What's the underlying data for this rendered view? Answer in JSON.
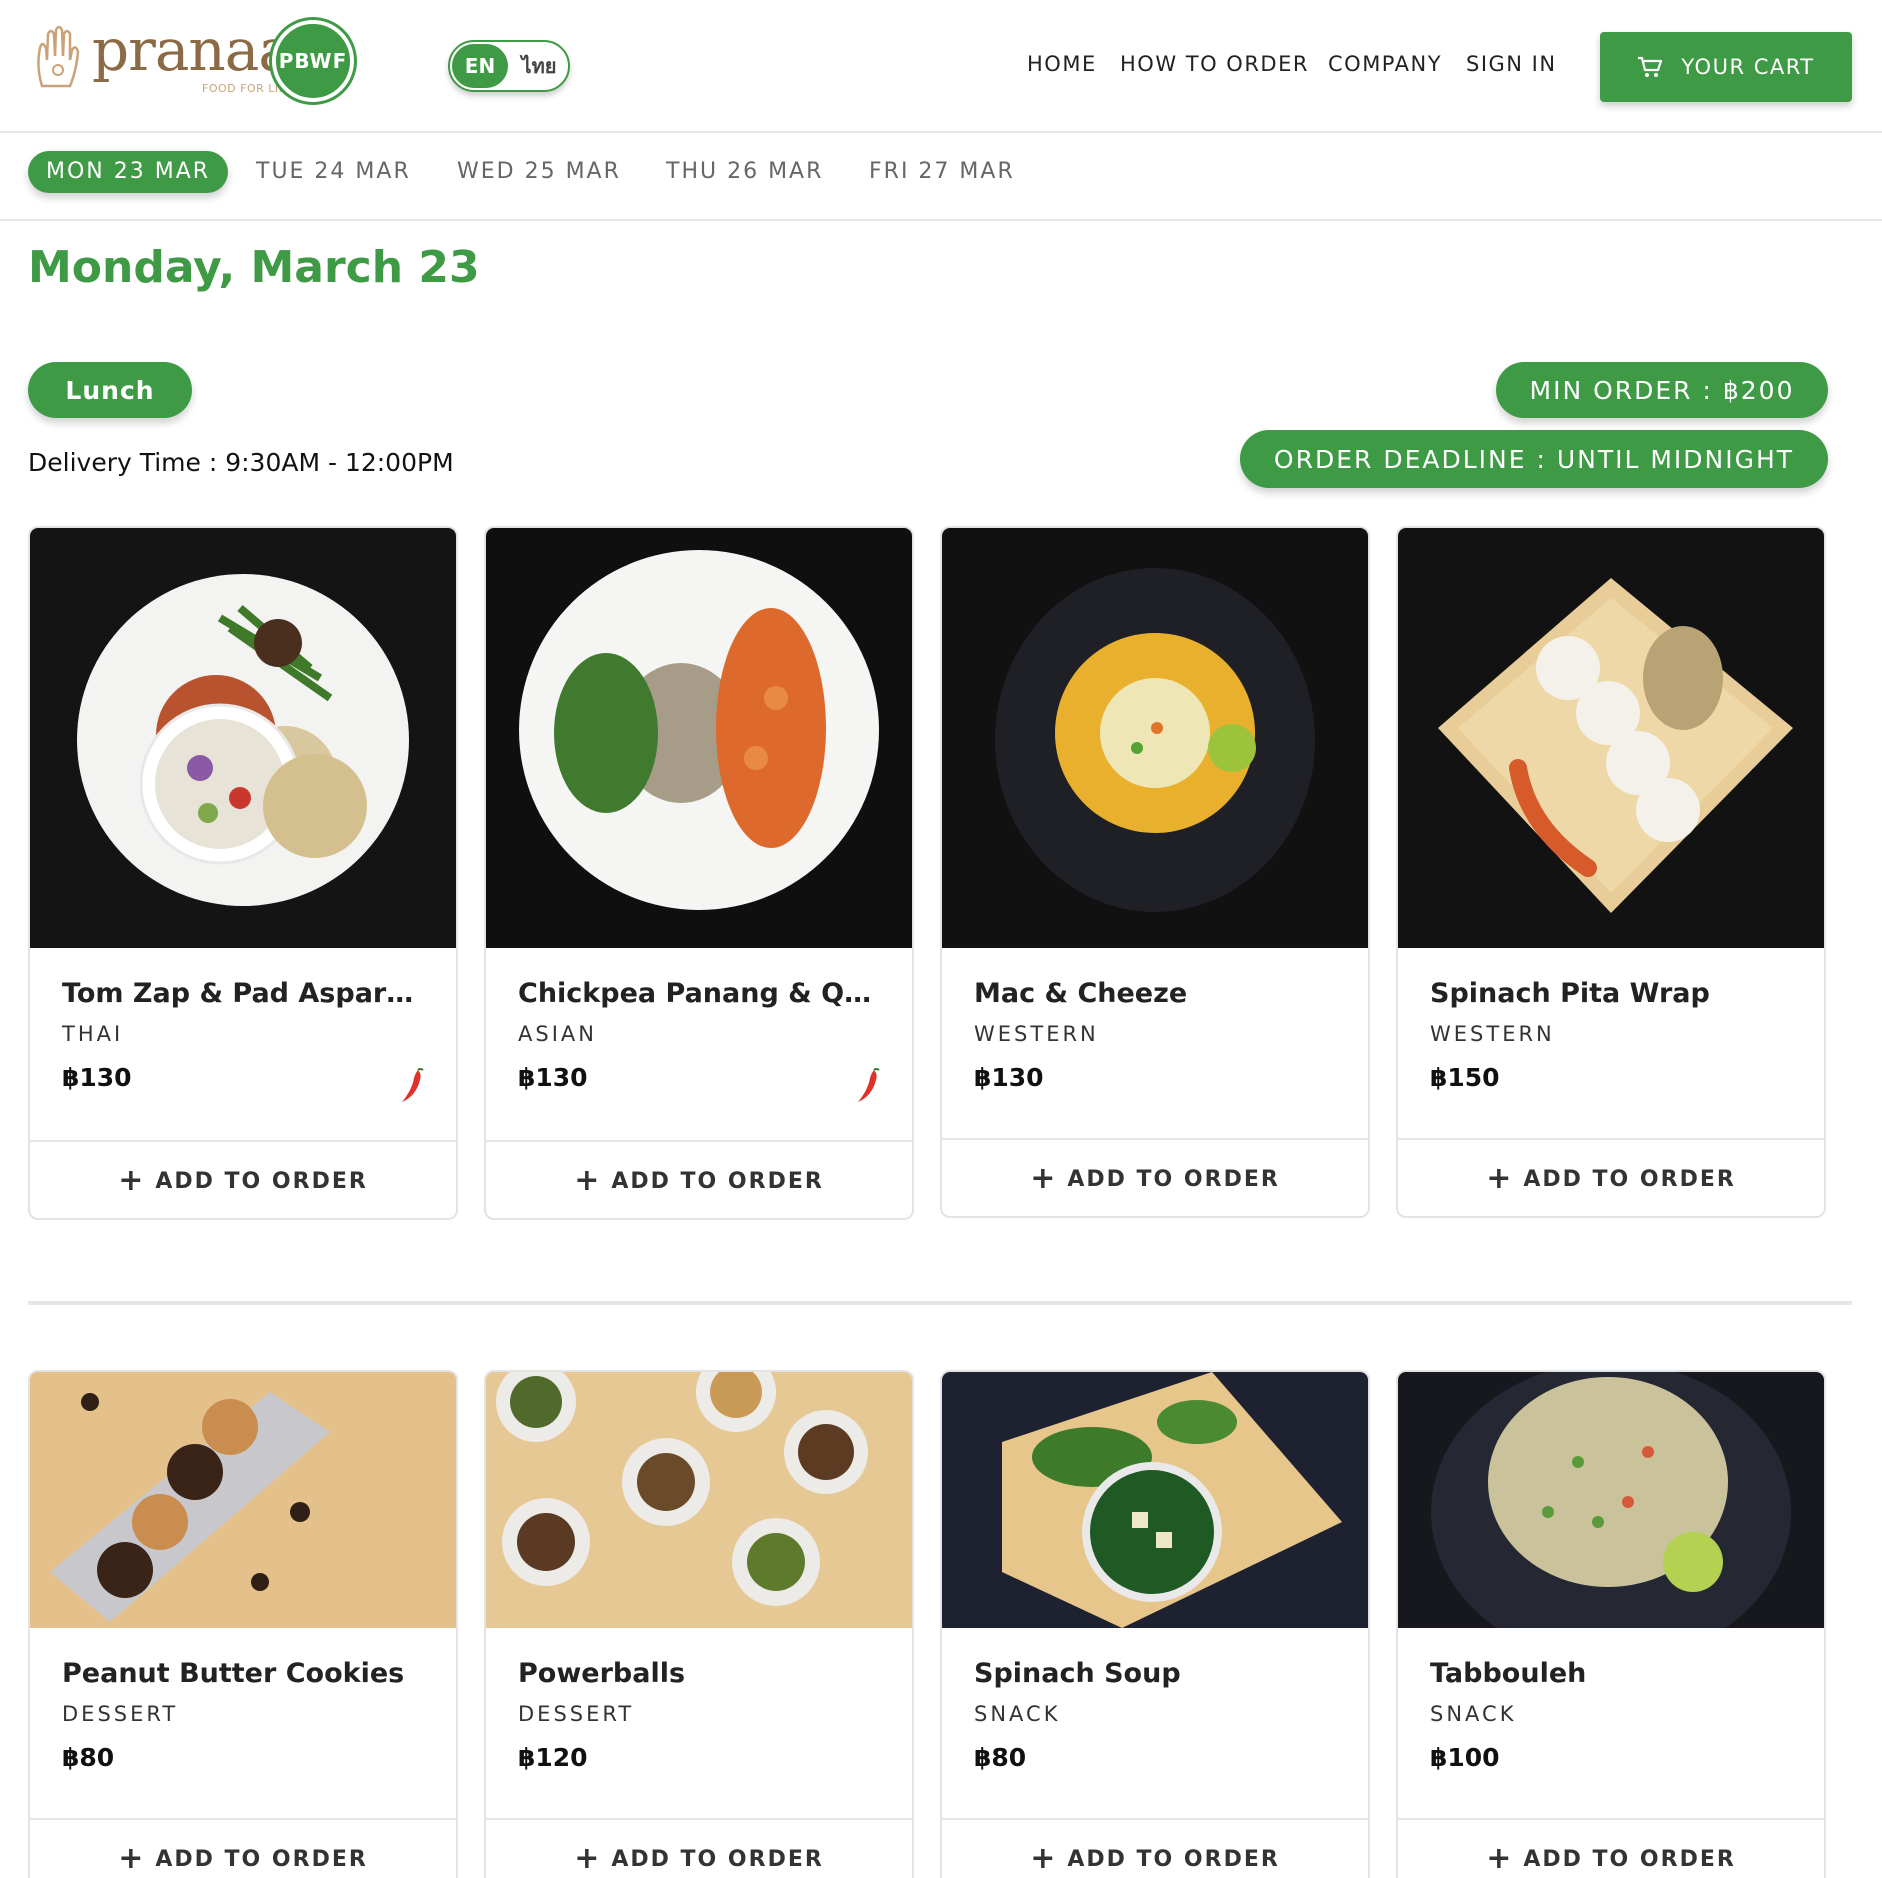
{
  "brand": {
    "name": "pranaa",
    "tagline": "FOOD FOR LIFE",
    "badge": "PBWF"
  },
  "lang": {
    "en": "EN",
    "th": "ไทย"
  },
  "nav": {
    "home": "HOME",
    "how": "HOW TO ORDER",
    "company": "COMPANY",
    "signin": "SIGN IN",
    "cart": "YOUR CART"
  },
  "days": [
    "MON 23 MAR",
    "TUE 24 MAR",
    "WED 25 MAR",
    "THU 26 MAR",
    "FRI 27 MAR"
  ],
  "page": {
    "title": "Monday, March 23",
    "meal": "Lunch",
    "delivery": "Delivery Time : 9:30AM - 12:00PM",
    "min_order": "MIN ORDER : ฿200",
    "deadline": "ORDER DEADLINE : UNTIL MIDNIGHT",
    "add_label": "ADD TO ORDER"
  },
  "mains": [
    {
      "name": "Tom Zap & Pad Asparagus",
      "category": "THAI",
      "price": "฿130",
      "spicy": true
    },
    {
      "name": "Chickpea Panang & Quin...",
      "category": "ASIAN",
      "price": "฿130",
      "spicy": true
    },
    {
      "name": "Mac & Cheeze",
      "category": "WESTERN",
      "price": "฿130",
      "spicy": false
    },
    {
      "name": "Spinach Pita Wrap",
      "category": "WESTERN",
      "price": "฿150",
      "spicy": false
    }
  ],
  "sides": [
    {
      "name": "Peanut Butter Cookies",
      "category": "DESSERT",
      "price": "฿80"
    },
    {
      "name": "Powerballs",
      "category": "DESSERT",
      "price": "฿120"
    },
    {
      "name": "Spinach Soup",
      "category": "SNACK",
      "price": "฿80"
    },
    {
      "name": "Tabbouleh",
      "category": "SNACK",
      "price": "฿100"
    }
  ],
  "colors": {
    "accent": "#3e9a45",
    "chili": "#e0302a"
  }
}
